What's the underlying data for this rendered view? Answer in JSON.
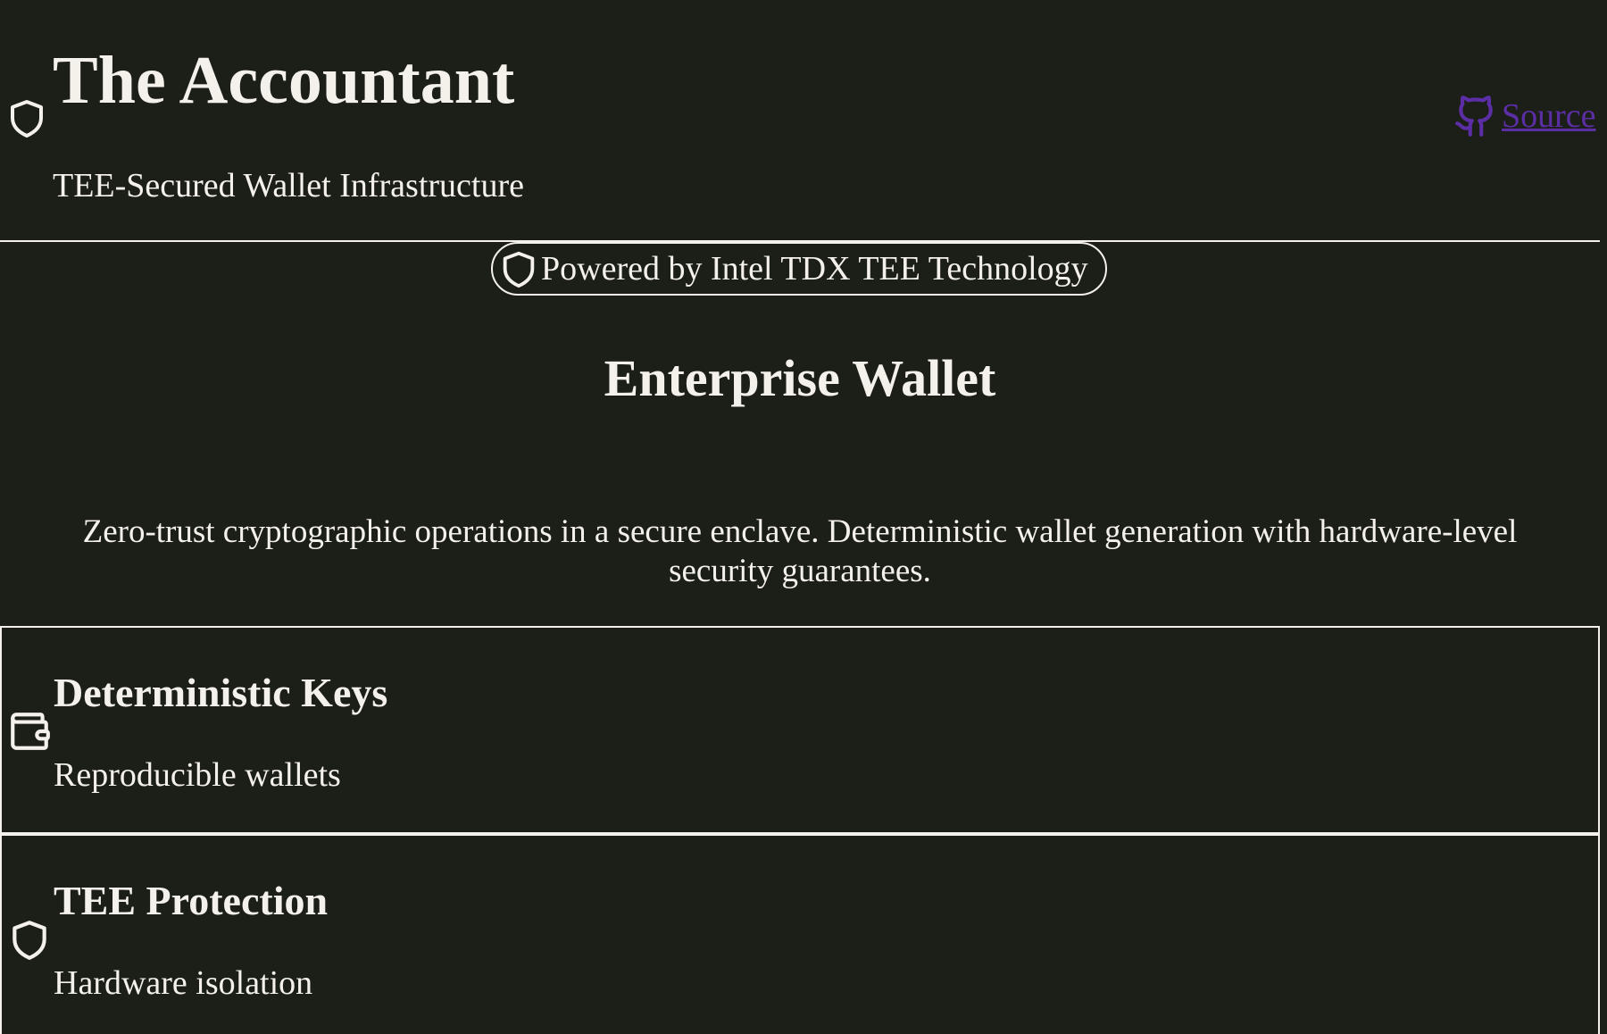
{
  "header": {
    "title": "The Accountant",
    "subtitle": "TEE-Secured Wallet Infrastructure",
    "brand_icon": "shield-icon",
    "source_link": {
      "label": "Source",
      "icon": "github-icon",
      "color": "#5b2ea6"
    }
  },
  "badge": {
    "icon": "shield-icon",
    "label": "Powered by Intel TDX TEE Technology"
  },
  "hero": {
    "title": "Enterprise Wallet",
    "description": "Zero-trust cryptographic operations in a secure enclave. Deterministic wallet generation with hardware-level security guarantees."
  },
  "features": [
    {
      "icon": "wallet-icon",
      "title": "Deterministic Keys",
      "description": "Reproducible wallets"
    },
    {
      "icon": "shield-icon",
      "title": "TEE Protection",
      "description": "Hardware isolation"
    }
  ],
  "colors": {
    "background": "#1c1e18",
    "foreground": "#f3f1e9",
    "link": "#5b2ea6"
  }
}
